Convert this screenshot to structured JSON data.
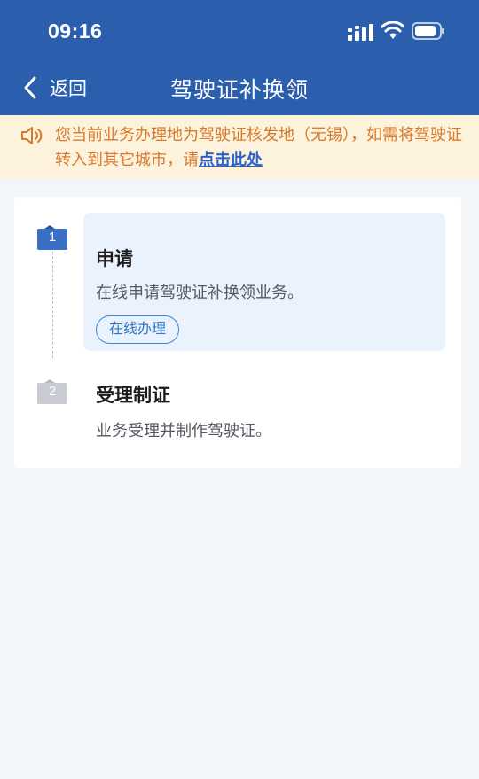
{
  "status_bar": {
    "time": "09:16"
  },
  "nav": {
    "back_label": "返回",
    "title": "驾驶证补换领"
  },
  "notice": {
    "text": "您当前业务办理地为驾驶证核发地（无锡），如需将驾驶证转入到其它城市，请",
    "link": "点击此处"
  },
  "steps": [
    {
      "number": "1",
      "title": "申请",
      "description": "在线申请驾驶证补换领业务。",
      "action": "在线办理"
    },
    {
      "number": "2",
      "title": "受理制证",
      "description": "业务受理并制作驾驶证。"
    }
  ],
  "colors": {
    "header": "#2b5fae",
    "notice_bg": "#fdf3dc",
    "notice_text": "#d9792b",
    "link": "#2b62c9",
    "active_step": "#3a6fc4",
    "inactive_step": "#c8ccd2",
    "panel_bg": "#eaf3fd"
  },
  "icons": [
    "chevron-left-icon",
    "speaker-icon",
    "signal-icon",
    "wifi-icon",
    "battery-icon"
  ]
}
